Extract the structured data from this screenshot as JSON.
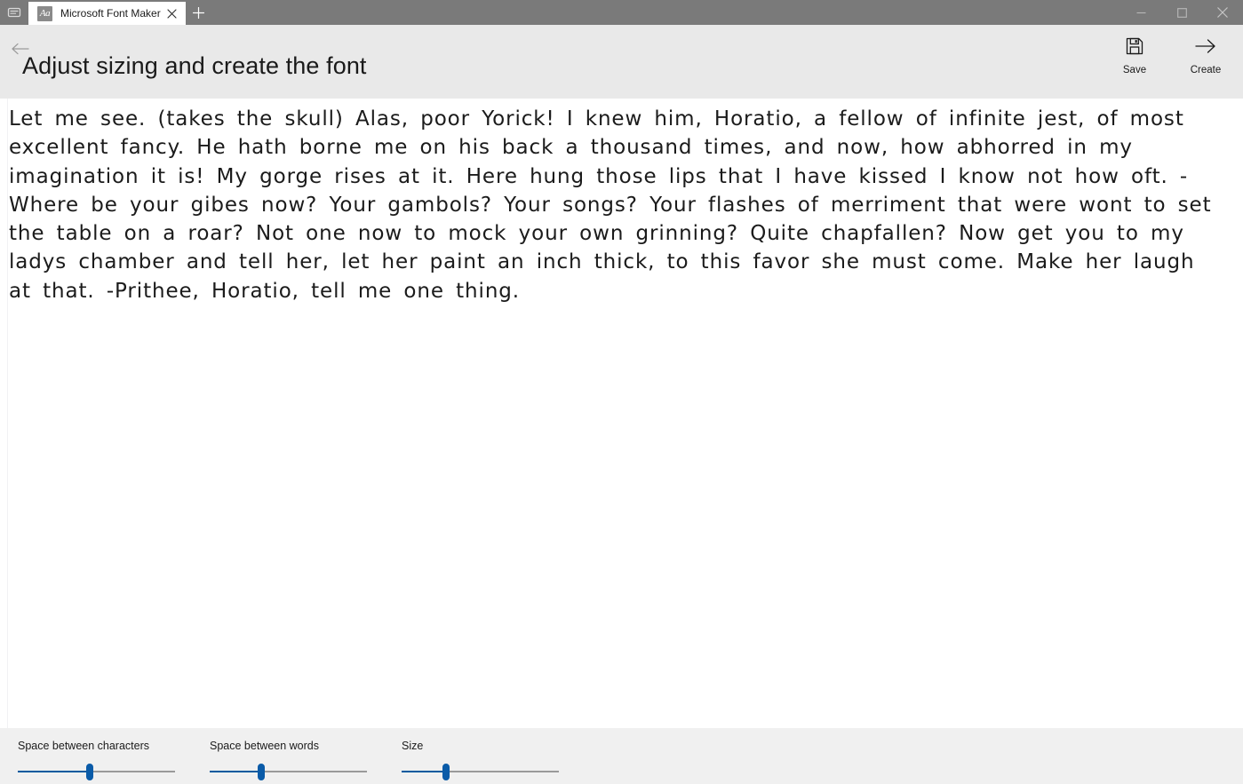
{
  "window": {
    "tablist_icon": "tab-list-icon",
    "tab": {
      "favicon_text": "Aa",
      "title": "Microsoft Font Maker",
      "close_icon": "close-icon"
    },
    "new_tab_icon": "plus-icon",
    "controls": {
      "minimize": "minimize-icon",
      "maximize": "maximize-icon",
      "close": "close-icon"
    }
  },
  "header": {
    "back_icon": "back-arrow-icon",
    "title": "Adjust sizing and create the font",
    "actions": [
      {
        "icon": "save-icon",
        "label": "Save"
      },
      {
        "icon": "arrow-right-icon",
        "label": "Create"
      }
    ]
  },
  "canvas": {
    "sample_text": "Let me see. (takes the skull) Alas, poor Yorick! I knew him, Horatio, a fellow of infinite jest, of most excellent fancy. He hath borne me on his back a thousand times, and now, how abhorred in my imagination it is! My gorge rises at it. Here hung those lips that I have kissed I know not how oft. -Where be your gibes now? Your gambols? Your songs? Your flashes of merriment that were wont to set the table on a roar? Not one now to mock your own grinning? Quite chapfallen? Now get you to my ladys chamber and tell her, let her paint an inch thick, to this favor she must come. Make her laugh at that. -Prithee, Horatio, tell me one thing."
  },
  "bottom_controls": {
    "sliders": [
      {
        "label": "Space between characters",
        "value_percent": 46
      },
      {
        "label": "Space between words",
        "value_percent": 33
      },
      {
        "label": "Size",
        "value_percent": 28
      }
    ]
  },
  "colors": {
    "titlebar": "#7a7a7a",
    "header": "#e9e9e9",
    "bottombar": "#f0f0f0",
    "accent": "#0a5ba8",
    "text": "#1b1b1b"
  }
}
